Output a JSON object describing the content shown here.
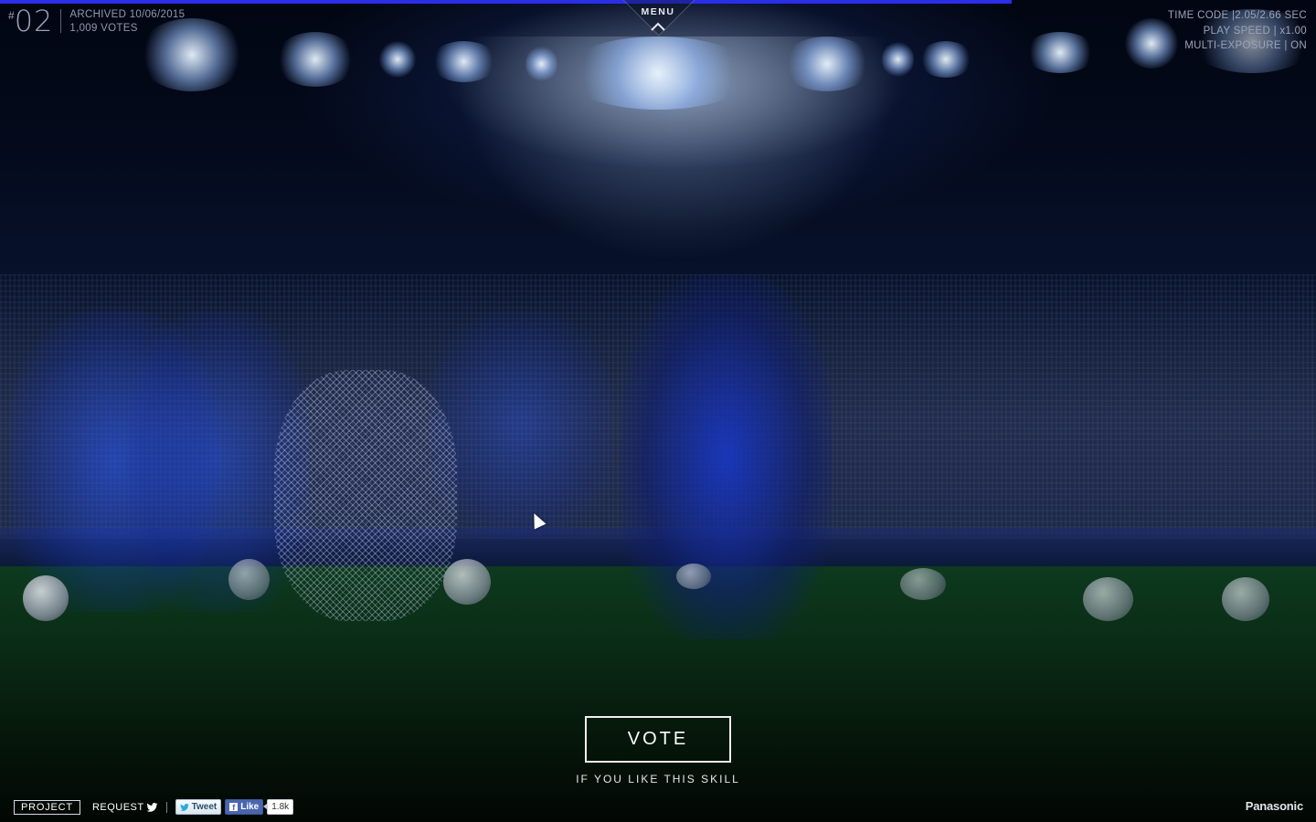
{
  "episode": {
    "hash": "#",
    "number": "02",
    "archived": "ARCHIVED 10/06/2015",
    "votes": "1,009 VOTES"
  },
  "progress": {
    "fraction": 0.769
  },
  "menu": {
    "label": "MENU",
    "icon": "chevron-up-icon"
  },
  "playback": {
    "time_code": "TIME CODE |2.05/2.66 SEC",
    "play_speed": "PLAY SPEED | x1.00",
    "multi_exposure": "MULTI-EXPOSURE | ON"
  },
  "vote": {
    "button_label": "VOTE",
    "caption": "IF YOU LIKE THIS SKILL"
  },
  "footer": {
    "project_label": "PROJECT",
    "request_label": "REQUEST",
    "request_icon": "twitter-bird-icon",
    "tweet_label": "Tweet",
    "like_label": "Like",
    "like_count": "1.8k"
  },
  "brand": "Panasonic",
  "colors": {
    "progress_bar": "#2a2ee8",
    "player_kit": "#1a3ec8",
    "facebook": "#4a66ad"
  }
}
